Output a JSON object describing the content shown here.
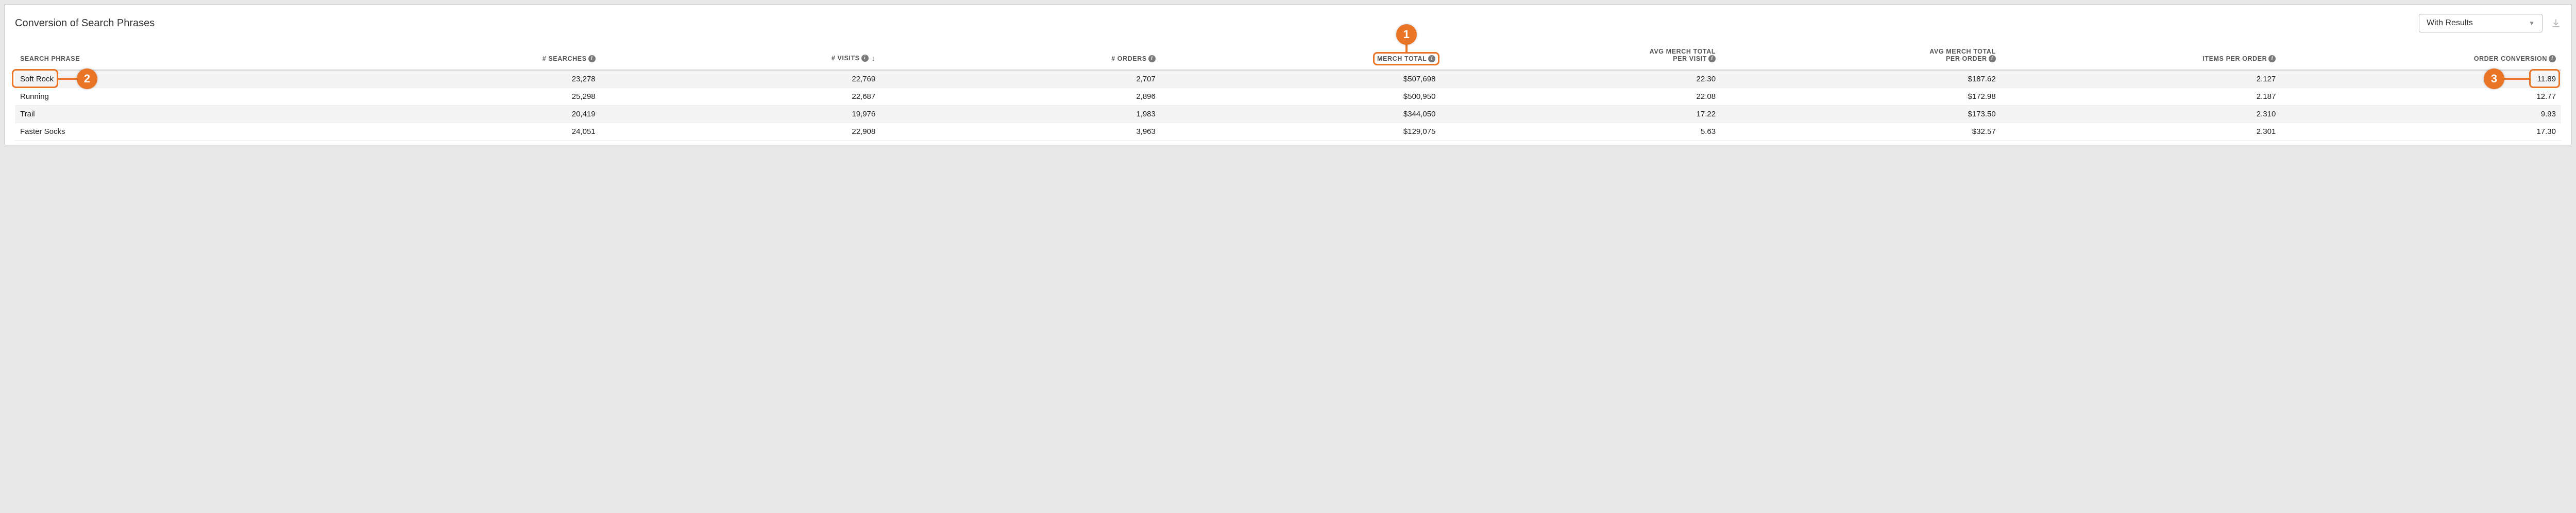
{
  "panel": {
    "title": "Conversion of Search Phrases",
    "dropdown_value": "With Results"
  },
  "columns": {
    "c0": "SEARCH PHRASE",
    "c1": "# SEARCHES",
    "c2": "# VISITS",
    "c3": "# ORDERS",
    "c4": "MERCH TOTAL",
    "c5a": "AVG MERCH TOTAL",
    "c5b": "PER VISIT",
    "c6a": "AVG MERCH TOTAL",
    "c6b": "PER ORDER",
    "c7": "ITEMS PER ORDER",
    "c8": "ORDER CONVERSION"
  },
  "rows": [
    {
      "phrase": "Soft Rock",
      "searches": "23,278",
      "visits": "22,769",
      "orders": "2,707",
      "merch": "$507,698",
      "avg_visit": "22.30",
      "avg_order": "$187.62",
      "items": "2.127",
      "conv": "11.89"
    },
    {
      "phrase": "Running",
      "searches": "25,298",
      "visits": "22,687",
      "orders": "2,896",
      "merch": "$500,950",
      "avg_visit": "22.08",
      "avg_order": "$172.98",
      "items": "2.187",
      "conv": "12.77"
    },
    {
      "phrase": "Trail",
      "searches": "20,419",
      "visits": "19,976",
      "orders": "1,983",
      "merch": "$344,050",
      "avg_visit": "17.22",
      "avg_order": "$173.50",
      "items": "2.310",
      "conv": "9.93"
    },
    {
      "phrase": "Faster Socks",
      "searches": "24,051",
      "visits": "22,908",
      "orders": "3,963",
      "merch": "$129,075",
      "avg_visit": "5.63",
      "avg_order": "$32.57",
      "items": "2.301",
      "conv": "17.30"
    }
  ],
  "callouts": {
    "b1": "1",
    "b2": "2",
    "b3": "3"
  }
}
